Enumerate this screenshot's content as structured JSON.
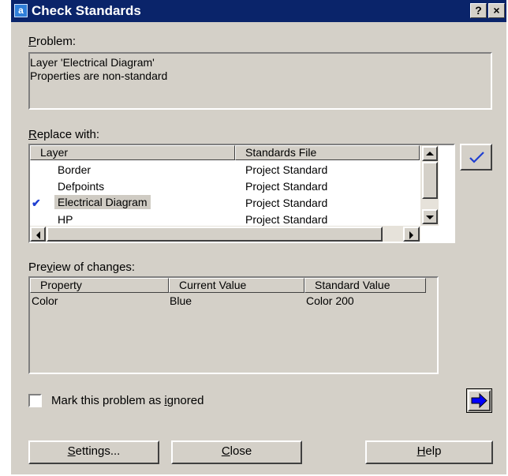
{
  "window": {
    "title": "Check Standards",
    "help_btn": "?",
    "close_btn": "×"
  },
  "problem": {
    "label_key": "P",
    "label_rest": "roblem:",
    "lines": [
      "Layer 'Electrical Diagram'",
      "Properties are non-standard"
    ]
  },
  "replace": {
    "label_key": "R",
    "label_rest": "eplace with:",
    "columns": [
      "Layer",
      "Standards File"
    ],
    "rows": [
      {
        "layer": "Border",
        "file": "Project Standard",
        "checked": false
      },
      {
        "layer": "Defpoints",
        "file": "Project Standard",
        "checked": false
      },
      {
        "layer": "Electrical Diagram",
        "file": "Project Standard",
        "checked": true
      },
      {
        "layer": "HP",
        "file": "Project Standard",
        "checked": false
      }
    ],
    "check_mark": "✔"
  },
  "preview": {
    "label_pre": "Pre",
    "label_key": "v",
    "label_rest": "iew of changes:",
    "columns": [
      "Property",
      "Current Value",
      "Standard Value"
    ],
    "rows": [
      {
        "property": "Color",
        "current": "Blue",
        "standard": "Color 200"
      }
    ]
  },
  "ignore": {
    "label_pre": "Mark this problem as ",
    "label_key": "i",
    "label_rest": "gnored",
    "checked": false
  },
  "buttons": {
    "settings": {
      "key": "S",
      "rest": "ettings..."
    },
    "close": {
      "key": "C",
      "rest": "lose"
    },
    "help": {
      "key": "H",
      "rest": "elp"
    }
  },
  "colors": {
    "title_bar": "#0a246a",
    "face": "#d4d0c8",
    "check": "#1f3fd1",
    "next_arrow": "#0000ff",
    "selection": "#cfcbc3"
  }
}
